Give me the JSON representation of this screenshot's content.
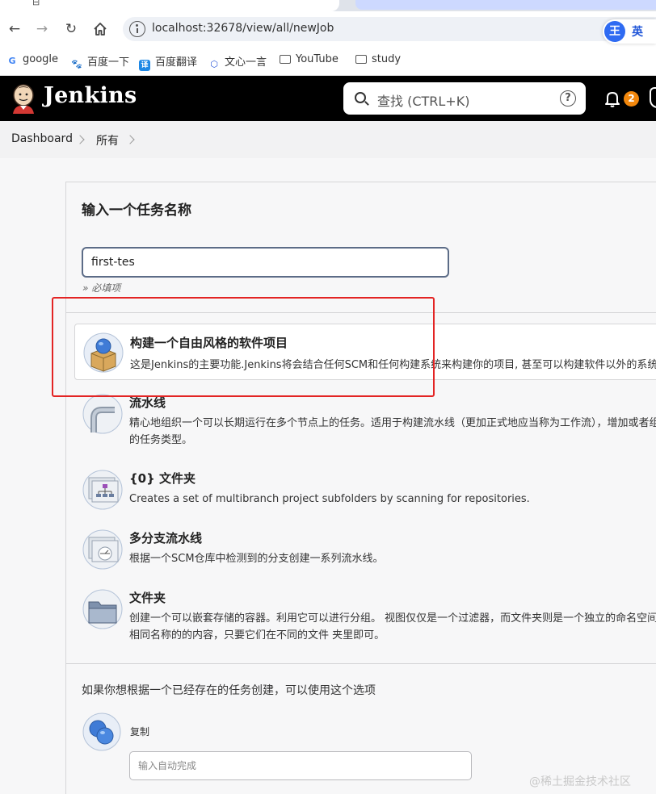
{
  "browser": {
    "tab_glyph": "⊟",
    "url": "localhost:32678/view/all/newJob",
    "ime": {
      "badge": "王",
      "lang": "英"
    },
    "bookmarks": [
      {
        "label": "google",
        "icon": "google-icon"
      },
      {
        "label": "百度一下",
        "icon": "baidu-icon"
      },
      {
        "label": "百度翻译",
        "icon": "baidu-translate-icon"
      },
      {
        "label": "文心一言",
        "icon": "wenxin-icon"
      },
      {
        "label": "YouTube",
        "icon": "folder-icon"
      },
      {
        "label": "study",
        "icon": "folder-icon"
      }
    ]
  },
  "header": {
    "brand": "Jenkins",
    "search_placeholder": "查找 (CTRL+K)",
    "help_glyph": "?",
    "notification_count": "2"
  },
  "breadcrumb": [
    "Dashboard",
    "所有"
  ],
  "form": {
    "title": "输入一个任务名称",
    "name_value": "first-tes",
    "required_hint": "» 必填项"
  },
  "job_types": [
    {
      "name": "构建一个自由风格的软件项目",
      "desc": [
        "这是Jenkins的主要功能.Jenkins将会结合任何SCM和任何构建系统来构建你的项目, 甚至可以构建软件以外的系统."
      ],
      "icon": "freestyle-box-icon",
      "selected": true
    },
    {
      "name": "流水线",
      "desc": [
        "精心地组织一个可以长期运行在多个节点上的任务。适用于构建流水线（更加正式地应当称为工作流），增加或者组织难以采用自由风格",
        "的任务类型。"
      ],
      "icon": "pipeline-icon",
      "selected": false
    },
    {
      "name": "{0} 文件夹",
      "desc": [
        "Creates a set of multibranch project subfolders by scanning for repositories."
      ],
      "icon": "org-folder-icon",
      "selected": false
    },
    {
      "name": "多分支流水线",
      "desc": [
        "根据一个SCM仓库中检测到的分支创建一系列流水线。"
      ],
      "icon": "multibranch-icon",
      "selected": false
    },
    {
      "name": "文件夹",
      "desc": [
        "创建一个可以嵌套存储的容器。利用它可以进行分组。 视图仅仅是一个过滤器，而文件夹则是一个独立的命名空间， 因此你可以有多个",
        "相同名称的的内容，只要它们在不同的文件 夹里即可。"
      ],
      "icon": "folder-icon",
      "selected": false
    }
  ],
  "copy": {
    "title": "如果你想根据一个已经存在的任务创建，可以使用这个选项",
    "label": "复制",
    "placeholder": "输入自动完成"
  },
  "watermark": "@稀土掘金技术社区",
  "colors": {
    "header_bg": "#000000",
    "badge": "#f2870c",
    "highlight": "#e32424",
    "input_border": "#5c6c87"
  }
}
